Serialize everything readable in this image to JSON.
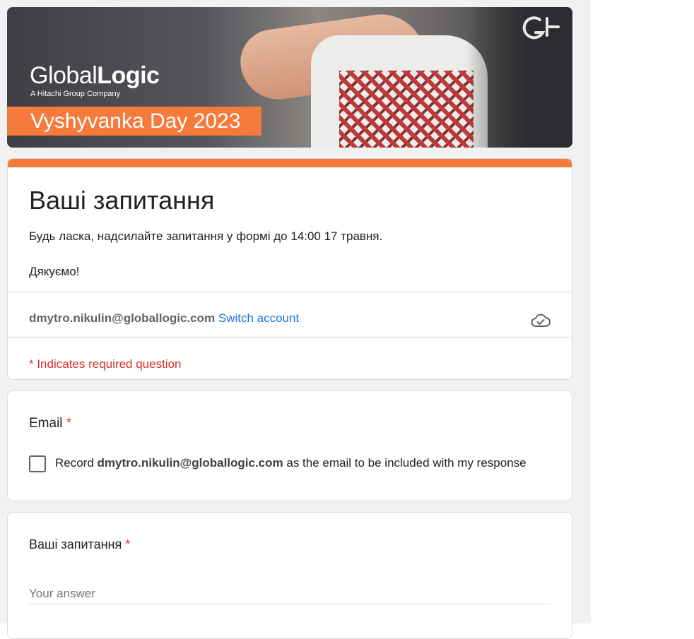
{
  "banner": {
    "brand_light": "Global",
    "brand_bold": "Logic",
    "brand_sub": "A Hitachi Group Company",
    "event_title": "Vyshyvanka Day 2023",
    "accent_color": "#f47b3c"
  },
  "form": {
    "title": "Ваші запитання",
    "description_line_1": "Будь ласка, надсилайте запитання у формі до 14:00 17 травня.",
    "description_line_2": "Дякуємо!",
    "account_email": "dmytro.nikulin@globallogic.com",
    "switch_account_label": "Switch account",
    "save_status_icon": "cloud-check-icon",
    "required_note": "* Indicates required question",
    "required_color": "#d93025"
  },
  "email_question": {
    "label": "Email",
    "required_mark": "*",
    "checkbox_prefix": "Record",
    "checkbox_email": "dmytro.nikulin@globallogic.com",
    "checkbox_suffix": "as the email to be included with my response",
    "checked": false
  },
  "questions_question": {
    "label": "Ваші запитання",
    "required_mark": "*",
    "answer_placeholder": "Your answer",
    "answer_value": ""
  }
}
